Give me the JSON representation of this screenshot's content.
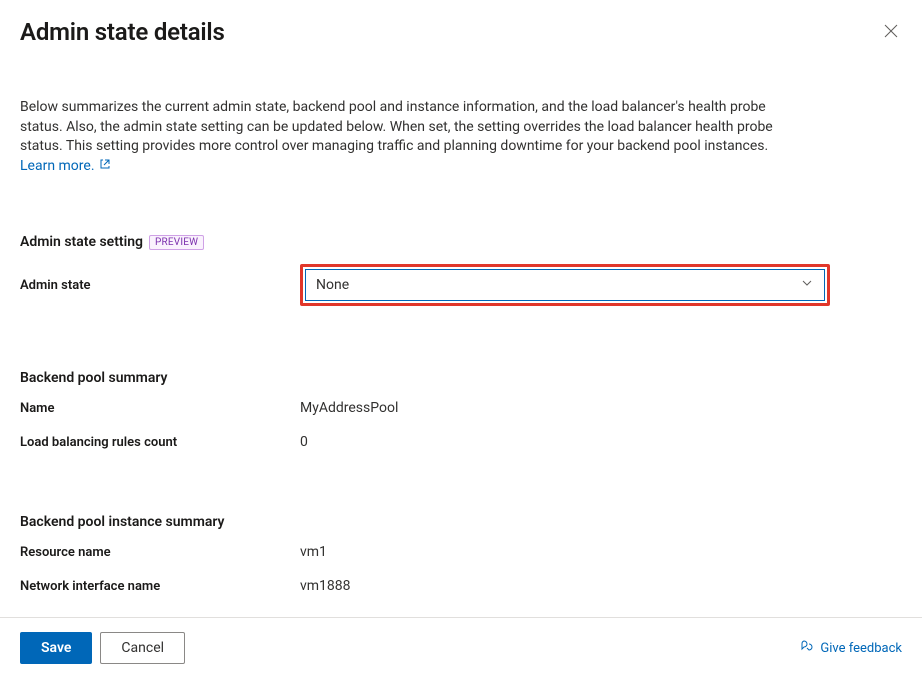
{
  "header": {
    "title": "Admin state details"
  },
  "description": {
    "text": "Below summarizes the current admin state, backend pool and instance information, and the load balancer's health probe status. Also, the admin state setting can be updated below. When set, the setting overrides the load balancer health probe status. This setting provides more control over managing traffic and planning downtime for your backend pool instances.",
    "learn_more_label": "Learn more."
  },
  "admin_state_section": {
    "heading": "Admin state setting",
    "badge": "PREVIEW",
    "field_label": "Admin state",
    "selected_value": "None"
  },
  "backend_pool_summary": {
    "heading": "Backend pool summary",
    "name_label": "Name",
    "name_value": "MyAddressPool",
    "rules_label": "Load balancing rules count",
    "rules_value": "0"
  },
  "instance_summary": {
    "heading": "Backend pool instance summary",
    "resource_label": "Resource name",
    "resource_value": "vm1",
    "nic_label": "Network interface name",
    "nic_value": "vm1888"
  },
  "footer": {
    "save_label": "Save",
    "cancel_label": "Cancel",
    "feedback_label": "Give feedback"
  }
}
